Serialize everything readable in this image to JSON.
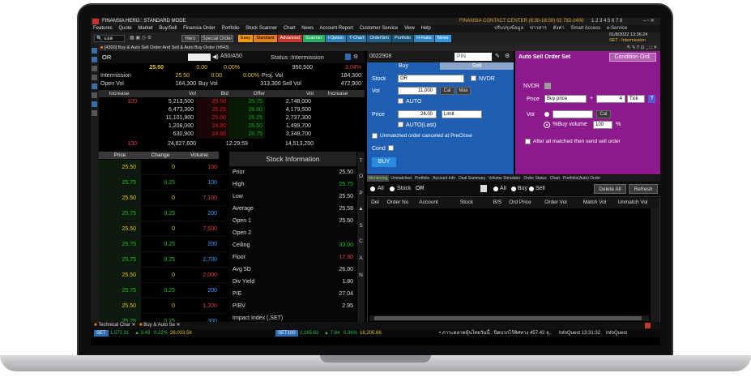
{
  "titlebar": {
    "title": "FINANSIA HERO : STANDARD MODE",
    "contact": "FINANSIA CONTACT CENTER (8:30-18:00) 02 782-2400",
    "tabs_numbers": "1 2 3 4 5 6 7 8"
  },
  "menu": [
    "Features",
    "Quote",
    "Market",
    "Buy/Sell",
    "Finansia Order",
    "Portfolio",
    "Stock Scanner",
    "Chart",
    "News",
    "Account Report",
    "Customer Service",
    "View",
    "Help"
  ],
  "menu_right": [
    "ปรับปรุงข้อมูล",
    "ข่าวสาร",
    "ตั้งค่า",
    "Smart Access",
    "e-Service"
  ],
  "datetime": "01/8/2022 13:36:24",
  "set_status": "SET : Intermission",
  "toolbar": {
    "search": "แอด",
    "buttons": [
      "Hero",
      "Special Order"
    ],
    "colored_tabs": [
      "Easy",
      "Standard",
      "Advanced",
      "Scanner",
      "I-Option",
      "T-Chart",
      "OrderSim",
      "Portfolio",
      "H-Ratio",
      "News"
    ]
  },
  "window_title": "[4300] Buy & Auto Sell Order And Sell & Auto Buy Order (#843)",
  "quote": {
    "symbol": "OR",
    "period": "A50/A50",
    "status": "Status :Intermission",
    "last": "25.50",
    "change": "0.00",
    "pct": "0.00%",
    "volume_top": "950,500",
    "pct_right": "3.04%",
    "row2_label": "Intermission",
    "row2_val": "25.50",
    "row2_chg": "0.00",
    "row2_pct": "0.00%",
    "row2_projlabel": "Proj. Vol",
    "row2_projval": "184,300",
    "row3_label": "Open Vol",
    "row3_openvol": "164,300",
    "row3_buyvol": "Buy Vol",
    "row3_sellvol": "313,300 Sell Vol",
    "row3_right": "472,900"
  },
  "orderbook": {
    "headers": [
      "Increase",
      "Vol",
      "Bid",
      "Offer",
      "Vol",
      "Increase"
    ],
    "rows": [
      {
        "inc": "100",
        "vol": "5,213,500",
        "bid": "25.50",
        "offer": "25.75",
        "ovol": "2,748,000",
        "oinc": ""
      },
      {
        "inc": "",
        "vol": "6,473,300",
        "bid": "25.25",
        "offer": "26.00",
        "ovol": "4,179,500",
        "oinc": ""
      },
      {
        "inc": "",
        "vol": "11,101,900",
        "bid": "25.00",
        "offer": "26.25",
        "ovol": "2,737,300",
        "oinc": ""
      },
      {
        "inc": "",
        "vol": "1,208,000",
        "bid": "24.90",
        "offer": "26.50",
        "ovol": "1,499,700",
        "oinc": ""
      },
      {
        "inc": "",
        "vol": "630,900",
        "bid": "24.80",
        "offer": "26.75",
        "ovol": "3,348,700",
        "oinc": ""
      }
    ],
    "total_inc": "100",
    "total_vol": "24,627,600",
    "time": "12:29:59",
    "total_ovol": "14,513,200"
  },
  "ticks": {
    "headers": [
      "Price",
      "Change",
      "Volume"
    ],
    "rows": [
      {
        "price": "25.50",
        "change": "0",
        "volume": "100"
      },
      {
        "price": "25.75",
        "change": "0.25",
        "volume": "100"
      },
      {
        "price": "25.50",
        "change": "0",
        "volume": "7,100"
      },
      {
        "price": "25.75",
        "change": "0.25",
        "volume": "200"
      },
      {
        "price": "25.50",
        "change": "0",
        "volume": "7,500"
      },
      {
        "price": "25.75",
        "change": "0.25",
        "volume": "200"
      },
      {
        "price": "25.75",
        "change": "0.25",
        "volume": "2,700"
      },
      {
        "price": "25.50",
        "change": "0",
        "volume": "2,000"
      },
      {
        "price": "25.75",
        "change": "0.25",
        "volume": "200"
      },
      {
        "price": "25.50",
        "change": "0",
        "volume": "1,300"
      },
      {
        "price": "25.75",
        "change": "0.25",
        "volume": "300"
      }
    ]
  },
  "stock_info": {
    "title": "Stock Information",
    "rows": [
      {
        "label": "Prior",
        "value": "25.50"
      },
      {
        "label": "High",
        "value": "25.75"
      },
      {
        "label": "Low",
        "value": "25.50"
      },
      {
        "label": "Average",
        "value": "25.58"
      },
      {
        "label": "Open 1",
        "value": "25.50"
      },
      {
        "label": "Open 2",
        "value": ""
      },
      {
        "label": "Ceiling",
        "value": "33.00"
      },
      {
        "label": "Floor",
        "value": "17.90"
      },
      {
        "label": "Avg 5D",
        "value": "26.00"
      },
      {
        "label": "Div Yield",
        "value": "1.80"
      },
      {
        "label": "P/E",
        "value": "27.04"
      },
      {
        "label": "P/BV",
        "value": "2.95"
      },
      {
        "label": "Impact Index (.SET)",
        "value": ""
      }
    ],
    "side_letters": [
      "T",
      "O",
      "P",
      "S",
      "C",
      "A",
      "N"
    ]
  },
  "order_panel": {
    "account": "0022908",
    "pin_placeholder": "PIN",
    "buy_tab": "Buy",
    "sell_tab": "Sell",
    "stock_label": "Stock",
    "stock_value": "OR",
    "nvdr_label": "NVDR",
    "vol_label": "Vol",
    "vol_value": "11,000",
    "cal_label": "Cal",
    "max_label": "Max",
    "auto_label": "AUTO",
    "price_label": "Price",
    "price_value": "24.00",
    "limit_value": "Limit",
    "auto_last_label": "AUTO(Last)",
    "unmatched_label": "Unmatched order canceled at PreClose",
    "cond_label": "Cond",
    "buy_button": "BUY"
  },
  "auto_sell": {
    "title": "Auto Sell Order Set",
    "condition_button": "Condition Ord.",
    "nvdr_label": "NVDR",
    "price_label": "Price",
    "price_type": "Buy price",
    "plus": "+",
    "tick_count": "4",
    "tick_unit": "Tick",
    "vol_label": "Vol",
    "cal_label": "Cal",
    "pct_buy_label": "%Buy volume",
    "pct_value": "100",
    "pct_sign": "%",
    "after_all_label": "After all matched then send sell order"
  },
  "bottom_tabs": [
    "Monitoring",
    "Unmatched",
    "Portfolio",
    "Account Info",
    "Deal Summary",
    "Volume Simulator",
    "Order Status",
    "Chart",
    "Portfolio(Auto) Order"
  ],
  "filter": {
    "all_label": "All",
    "stock_label": "Stock",
    "stock_value": "OR",
    "all2": "All",
    "buy": "Buy",
    "sell": "Sell",
    "delete_all": "Delete All",
    "refresh": "Refresh"
  },
  "orders_table": {
    "headers": [
      "Del",
      "Order No",
      "Account",
      "Stock",
      "B/S",
      "Ord Price",
      "Order Vol",
      "Match Vol",
      "Unmatch Vol"
    ]
  },
  "taskbar": {
    "items": [
      "Technical Char",
      "Buy & Auto Se"
    ]
  },
  "ticker": {
    "set_label": "SET",
    "set_val": "1,572.31",
    "set_chg": "▲ 3.48",
    "set_pct": "0.22%",
    "set_vol": "26,033.58",
    "set100_label": "SET100",
    "set100_val": "2,165.63",
    "set100_chg": "▲ 7.84",
    "set100_pct": "0.36%",
    "set100_vol": "18,205.66",
    "news": "• ภาวะตลาดหุ้นไทยวันนี้ : ปิดบวกไร้ทิศทาง 457.42 จุ..",
    "infoquest_time": "InfoQuest 13:31:32",
    "infoquest2": "InfoQuest"
  },
  "colors": {
    "buy_blue": "#1e5fb3",
    "auto_sell_purple": "#8c1a8c",
    "bid_red": "#d02020",
    "offer_green": "#18a018",
    "price_yellow": "#e6c229"
  }
}
